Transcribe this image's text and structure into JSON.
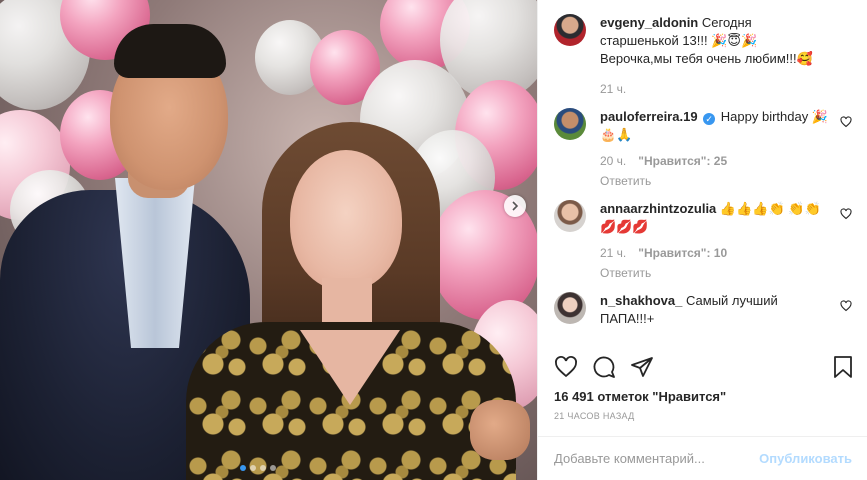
{
  "post": {
    "caption": {
      "username": "evgeny_aldonin",
      "text": "Сегодня старшенькой 13!!! 🎉😇🎉 Верочка,мы тебя очень любим!!!🥰",
      "time": "21 ч."
    },
    "comments": [
      {
        "username": "pauloferreira.19",
        "verified": true,
        "text": "Happy birthday 🎉🎂🙏",
        "time": "20 ч.",
        "likes_label": "\"Нравится\": 25",
        "reply_label": "Ответить"
      },
      {
        "username": "annaarzhintzozulia",
        "verified": false,
        "text": "👍👍👍👏 👏👏💋💋💋",
        "time": "21 ч.",
        "likes_label": "\"Нравится\": 10",
        "reply_label": "Ответить"
      },
      {
        "username": "n_shakhova_",
        "verified": false,
        "text": "Самый лучший ПАПА!!!+"
      }
    ],
    "likes_text": "16 491 отметок \"Нравится\"",
    "posted_ago": "21 часов назад",
    "carousel": {
      "total": 4,
      "current": 1
    }
  },
  "comment_bar": {
    "placeholder": "Добавьте комментарий...",
    "publish_label": "Опубликовать"
  },
  "icons": {
    "like": "heart-icon",
    "comment": "comment-icon",
    "share": "share-icon",
    "save": "bookmark-icon",
    "next": "chevron-right-icon",
    "verified": "verified-badge-icon"
  },
  "colors": {
    "accent": "#3897f0",
    "muted": "#999999",
    "publish_disabled": "#b3dbff"
  }
}
